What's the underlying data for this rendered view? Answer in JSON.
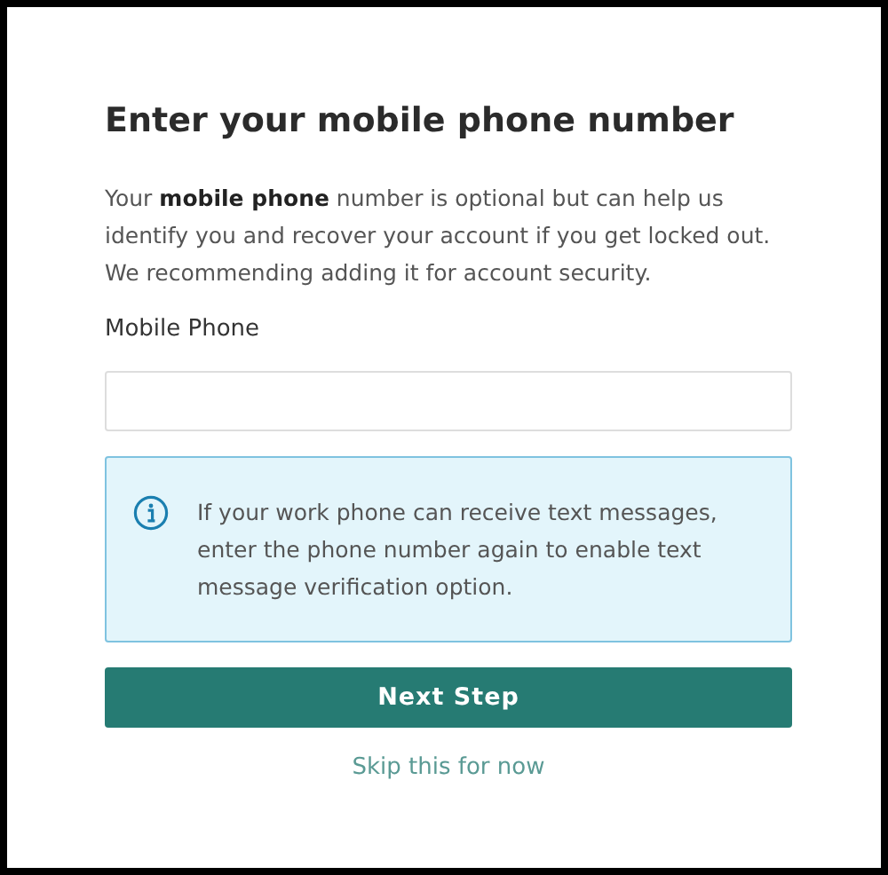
{
  "title": "Enter your mobile phone number",
  "description": "Your **mobile phone** number is optional but can help us identify you and recover your account if you get locked out. We recommending adding it for account security.",
  "field": {
    "label": "Mobile Phone"
  },
  "info": {
    "text": "If your work phone can receive text messages, enter the phone number again to enable text message verification option."
  },
  "primary_button": "Next Step",
  "skip_link": "Skip this for now"
}
